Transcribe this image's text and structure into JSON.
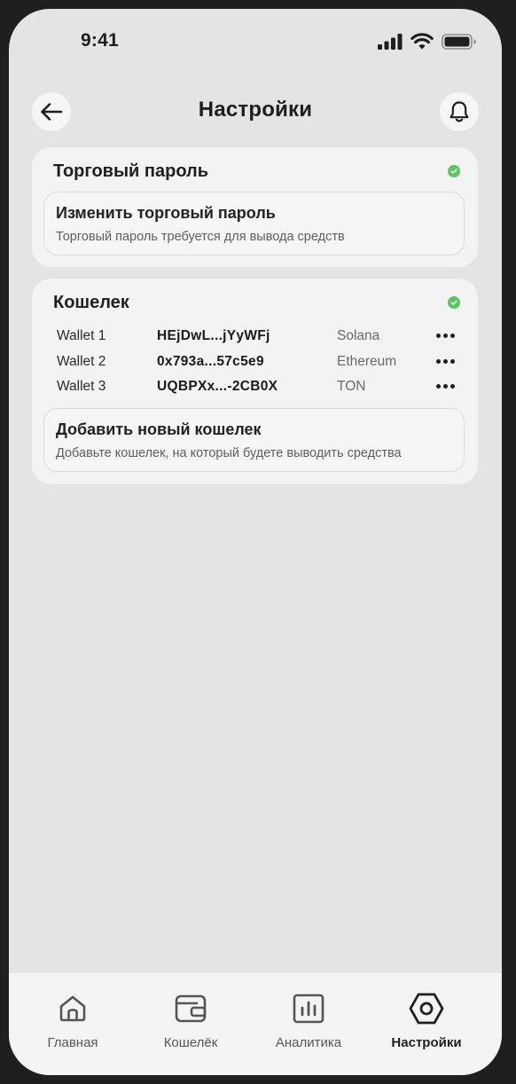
{
  "status": {
    "time": "9:41"
  },
  "header": {
    "title": "Настройки"
  },
  "trading_card": {
    "title": "Торговый пароль",
    "status_color": "#5cc560",
    "option": {
      "title": "Изменить торговый пароль",
      "subtitle": "Торговый пароль требуется для вывода средств"
    }
  },
  "wallet_card": {
    "title": "Кошелек",
    "status_color": "#5cc560",
    "wallets": [
      {
        "name": "Wallet 1",
        "address": "HEjDwL...jYyWFj",
        "network": "Solana"
      },
      {
        "name": "Wallet 2",
        "address": "0x793a...57c5e9",
        "network": "Ethereum"
      },
      {
        "name": "Wallet 3",
        "address": "UQBPXx...-2CB0X",
        "network": "TON"
      }
    ],
    "add_option": {
      "title": "Добавить новый кошелек",
      "subtitle": "Добавьте кошелек, на который будете выводить средства"
    }
  },
  "tabbar": {
    "tabs": [
      {
        "label": "Главная",
        "icon": "home-icon",
        "active": false
      },
      {
        "label": "Кошелёк",
        "icon": "wallet-icon",
        "active": false
      },
      {
        "label": "Аналитика",
        "icon": "analytics-icon",
        "active": false
      },
      {
        "label": "Настройки",
        "icon": "settings-icon",
        "active": true
      }
    ]
  }
}
